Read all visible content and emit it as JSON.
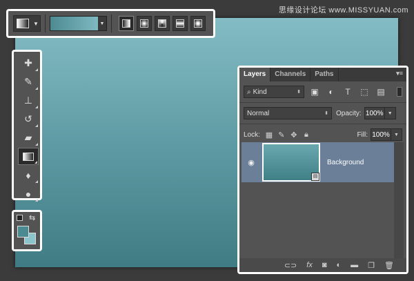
{
  "watermark": "思缘设计论坛 www.MISSYUAN.com",
  "colors": {
    "foreground": "#4c8a92",
    "background": "#8cc4cc"
  },
  "options_bar": {
    "gradient_types": [
      "linear-gradient-icon",
      "radial-gradient-icon",
      "angle-gradient-icon",
      "reflected-gradient-icon",
      "diamond-gradient-icon"
    ]
  },
  "layers_panel": {
    "tabs": [
      "Layers",
      "Channels",
      "Paths"
    ],
    "filter_kind": "Kind",
    "blend_mode": "Normal",
    "opacity_label": "Opacity:",
    "opacity_value": "100%",
    "lock_label": "Lock:",
    "fill_label": "Fill:",
    "fill_value": "100%",
    "layer_name": "Background"
  }
}
